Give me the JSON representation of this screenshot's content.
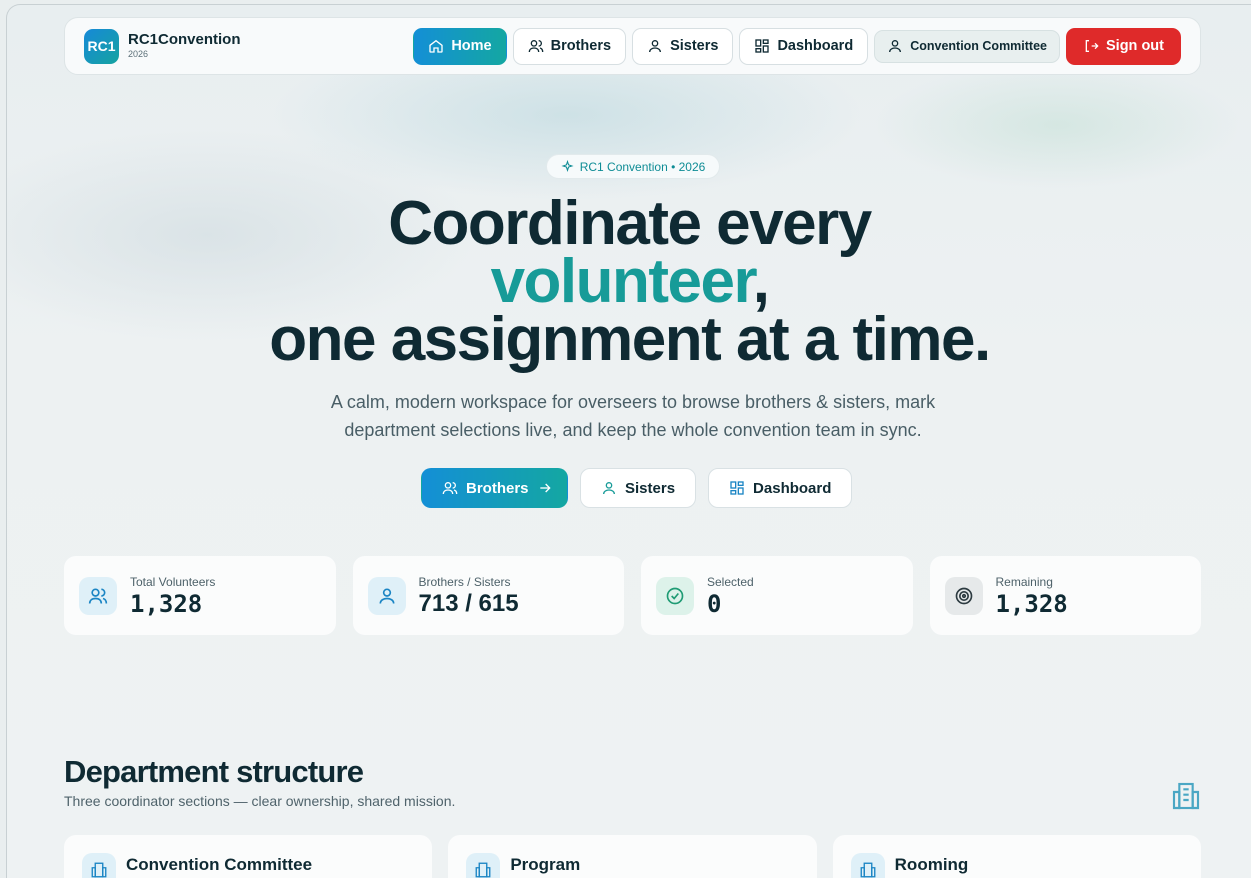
{
  "brand": {
    "logo_text": "RC1",
    "name": "RC1Convention",
    "year": "2026"
  },
  "nav": {
    "items": [
      {
        "label": "Home",
        "icon": "home-icon",
        "active": true
      },
      {
        "label": "Brothers",
        "icon": "users-icon"
      },
      {
        "label": "Sisters",
        "icon": "user-icon"
      },
      {
        "label": "Dashboard",
        "icon": "dashboard-icon"
      }
    ],
    "committee_label": "Convention Committee",
    "signout_label": "Sign out"
  },
  "hero": {
    "badge": "RC1 Convention • 2026",
    "title_line1": "Coordinate every",
    "title_accent": "volunteer",
    "title_comma": ",",
    "title_line3": "one assignment at a time.",
    "subtitle": "A calm, modern workspace for overseers to browse brothers & sisters, mark department selections live, and keep the whole convention team in sync.",
    "cta_brothers": "Brothers",
    "cta_sisters": "Sisters",
    "cta_dashboard": "Dashboard"
  },
  "stats": [
    {
      "label": "Total Volunteers",
      "value": "1,328",
      "icon": "users-icon"
    },
    {
      "label": "Brothers / Sisters",
      "value": "713 / 615",
      "icon": "user-icon"
    },
    {
      "label": "Selected",
      "value": "0",
      "icon": "check-circle-icon"
    },
    {
      "label": "Remaining",
      "value": "1,328",
      "icon": "target-icon"
    }
  ],
  "departments": {
    "title": "Department structure",
    "subtitle": "Three coordinator sections — clear ownership, shared mission.",
    "cards": [
      {
        "name": "Convention Committee",
        "icon": "building-icon"
      },
      {
        "name": "Program",
        "icon": "building-icon"
      },
      {
        "name": "Rooming",
        "icon": "building-icon"
      }
    ]
  },
  "colors": {
    "primary": "#148fd6",
    "accent": "#179b98",
    "danger": "#df2a2a"
  }
}
